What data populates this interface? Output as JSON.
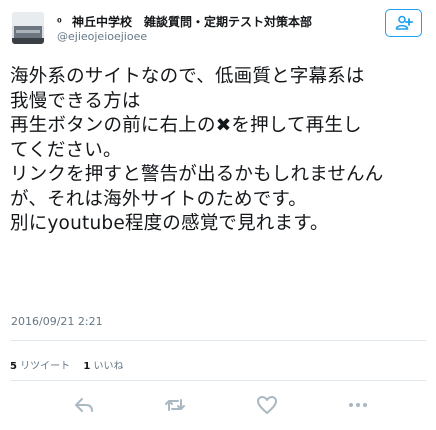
{
  "user": {
    "display_name": "神丘中学校　雑談質問・定期テスト対策本部",
    "screen_name": "@ejieojeioejioee"
  },
  "tweet": {
    "lines": [
      "海外系のサイトなので、低画質と字幕系は",
      "我慢できる方は",
      "再生ボタンの前に右上の✖︎を押して再生し",
      "てください。",
      "リンクを押すと警告が出るかもしれませんん",
      "が、それは海外サイトのためです。",
      "別にyoutube程度の感覚で見れます。"
    ],
    "timestamp": "2016/09/21 2:21"
  },
  "stats": {
    "retweets_count": "5",
    "retweets_label": "リツイート",
    "likes_count": "1",
    "likes_label": "いいね"
  },
  "icons": {
    "follow": "follow-person-icon",
    "reply": "reply-icon",
    "retweet": "retweet-icon",
    "like": "heart-icon",
    "more": "more-dots-icon"
  },
  "colors": {
    "accent": "#1da1f2",
    "muted": "#657786",
    "icon": "#aab8c2"
  }
}
